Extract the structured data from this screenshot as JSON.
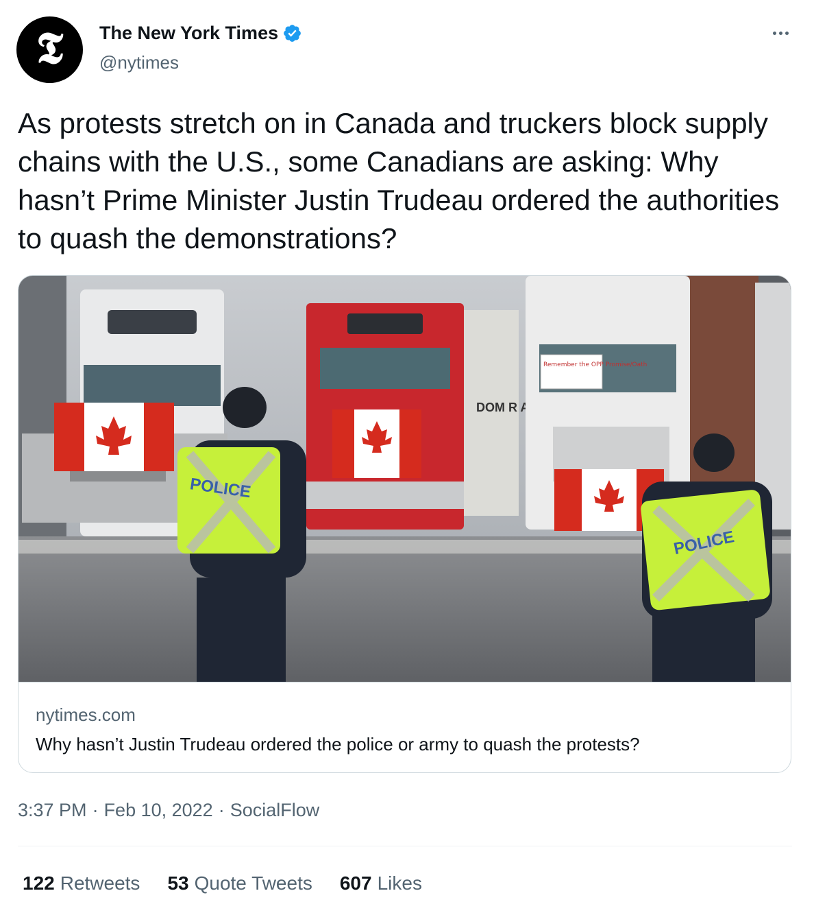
{
  "author": {
    "display_name": "The New York Times",
    "handle": "@nytimes",
    "avatar_glyph": "𝕿",
    "verified": true,
    "verified_color": "#1d9bf0"
  },
  "more_icon": "more-horizontal-icon",
  "tweet": {
    "text": "As protests stretch on in Canada and truckers block supply chains with the U.S., some Canadians are asking: Why hasn’t Prime Minister Justin Trudeau ordered the authorities to quash the demonstrations?"
  },
  "card": {
    "domain": "nytimes.com",
    "title": "Why hasn’t Justin Trudeau ordered the police or army to quash the protests?",
    "image_signs": {
      "police_left": "POLICE",
      "police_right": "POLICE",
      "truck_sign": "Remember the OPP Promise/Oath",
      "truck_partial_text": "DOM R AR ATES"
    }
  },
  "meta": {
    "time": "3:37 PM",
    "separator": "·",
    "date": "Feb 10, 2022",
    "source": "SocialFlow"
  },
  "stats": {
    "retweets_count": "122",
    "retweets_label": "Retweets",
    "quotes_count": "53",
    "quotes_label": "Quote Tweets",
    "likes_count": "607",
    "likes_label": "Likes"
  },
  "colors": {
    "text_primary": "#0f1419",
    "text_secondary": "#536471",
    "border": "#cfd9de",
    "accent": "#1d9bf0",
    "vest": "#c6f03a",
    "flag_red": "#d52b1e"
  }
}
